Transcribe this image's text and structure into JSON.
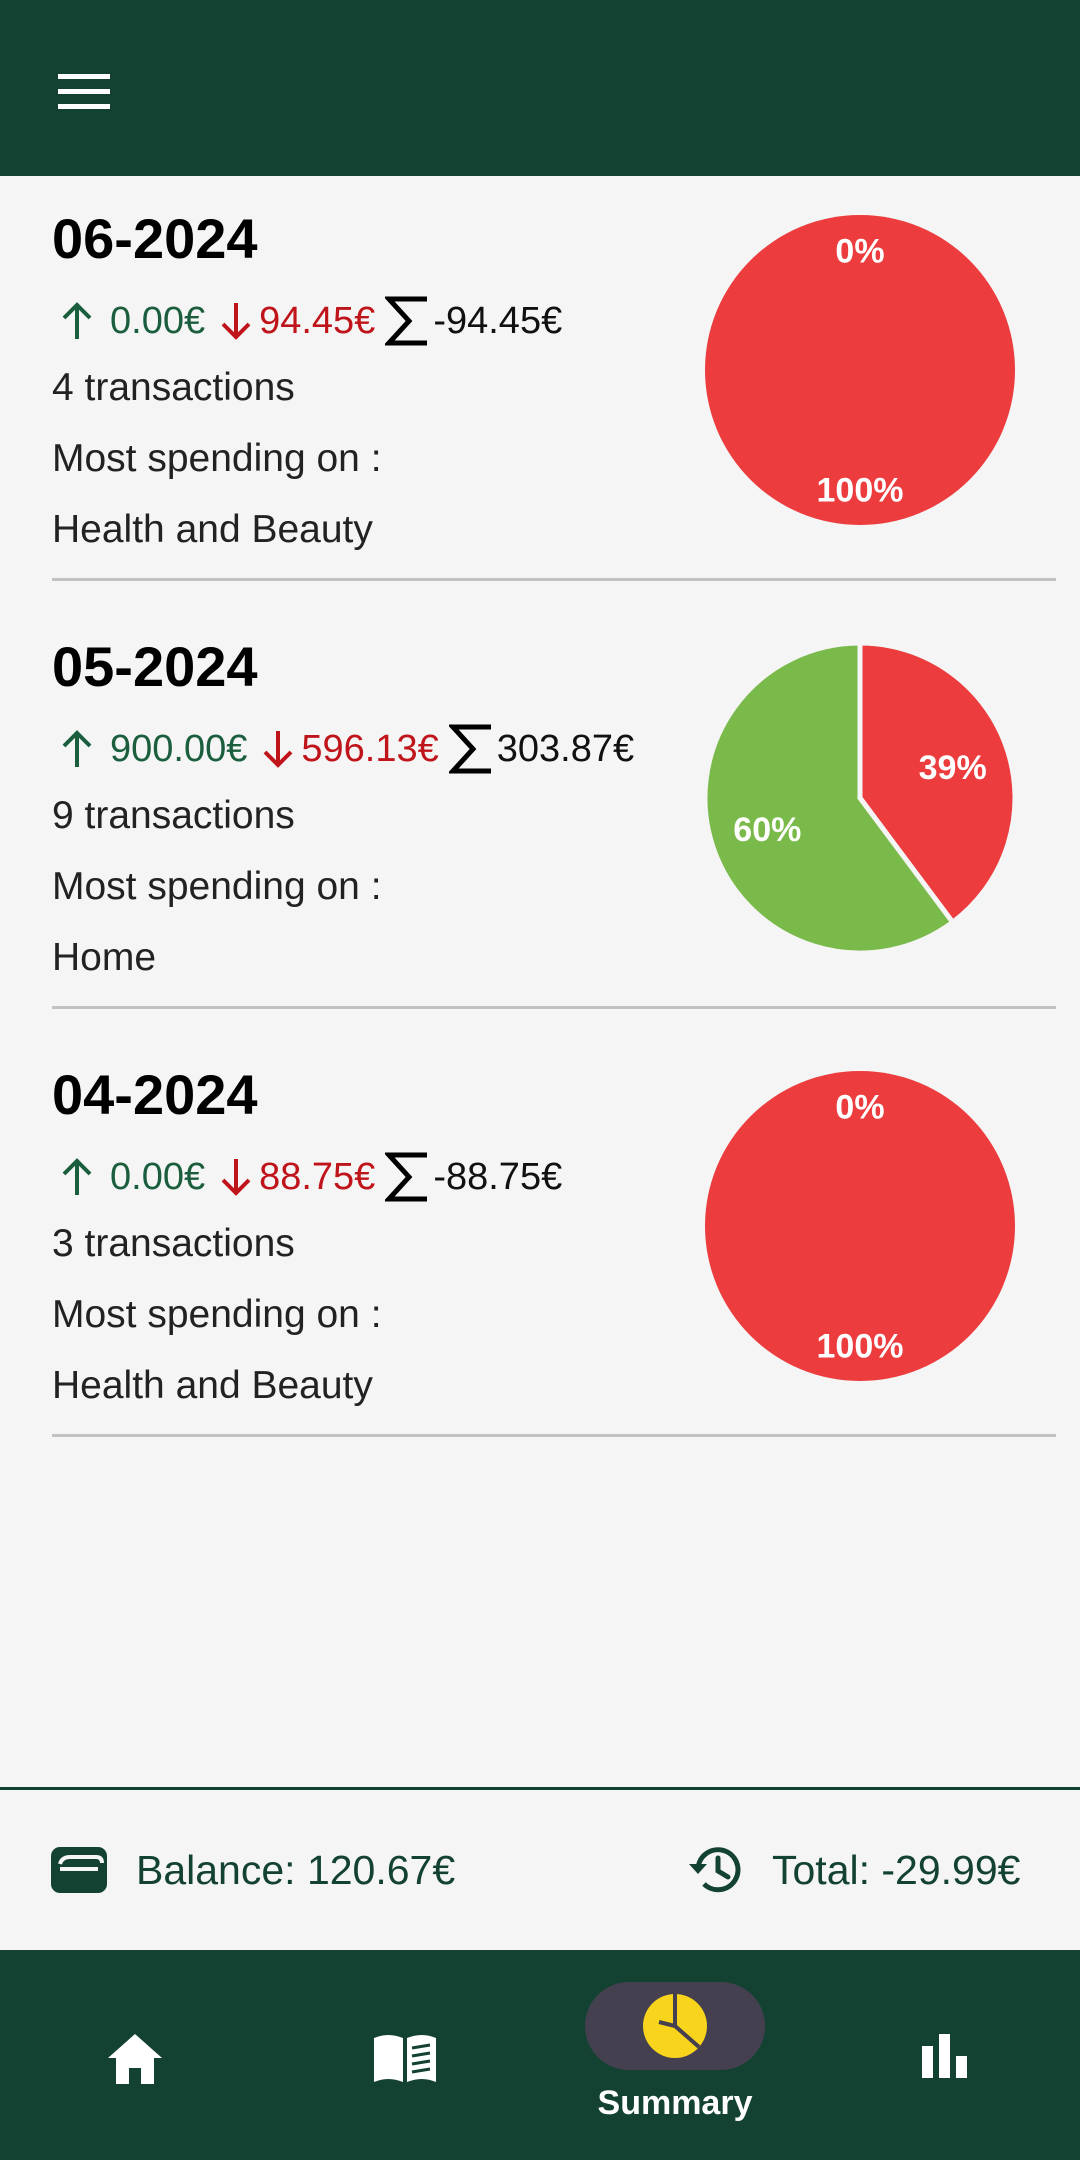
{
  "app": {
    "colors": {
      "primary": "#134232",
      "income": "#1b5e3e",
      "expense": "#c0141b",
      "pie_expense": "#ec3c3e",
      "pie_income": "#7aba4a",
      "nav_active": "#45404f",
      "summary_icon": "#f8d41c"
    }
  },
  "topbar": {
    "menu_icon": "hamburger-menu-icon"
  },
  "months": [
    {
      "title": "06-2024",
      "income": "0.00€",
      "expense": "94.45€",
      "total": "-94.45€",
      "transactions": "4 transactions",
      "most_spending_label": "Most spending on :",
      "most_spending_category": "Health and Beauty",
      "chart_data": {
        "type": "pie",
        "slices": [
          {
            "label": "0%",
            "value": 0,
            "color": "#7aba4a"
          },
          {
            "label": "100%",
            "value": 100,
            "color": "#ec3c3e"
          }
        ]
      }
    },
    {
      "title": "05-2024",
      "income": "900.00€",
      "expense": "596.13€",
      "total": "303.87€",
      "transactions": "9 transactions",
      "most_spending_label": "Most spending on :",
      "most_spending_category": "Home",
      "chart_data": {
        "type": "pie",
        "slices": [
          {
            "label": "60%",
            "value": 60.2,
            "color": "#7aba4a"
          },
          {
            "label": "39%",
            "value": 39.8,
            "color": "#ec3c3e"
          }
        ]
      }
    },
    {
      "title": "04-2024",
      "income": "0.00€",
      "expense": "88.75€",
      "total": "-88.75€",
      "transactions": "3 transactions",
      "most_spending_label": "Most spending on :",
      "most_spending_category": "Health and Beauty",
      "chart_data": {
        "type": "pie",
        "slices": [
          {
            "label": "0%",
            "value": 0,
            "color": "#7aba4a"
          },
          {
            "label": "100%",
            "value": 100,
            "color": "#ec3c3e"
          }
        ]
      }
    }
  ],
  "footer": {
    "balance": "Balance: 120.67€",
    "total": "Total: -29.99€",
    "balance_icon": "wallet-icon",
    "total_icon": "history-icon"
  },
  "bottom_nav": {
    "items": [
      {
        "icon": "home-icon",
        "label": ""
      },
      {
        "icon": "book-icon",
        "label": ""
      },
      {
        "icon": "pie-chart-icon",
        "label": "Summary",
        "active": true
      },
      {
        "icon": "bar-chart-icon",
        "label": ""
      }
    ]
  }
}
